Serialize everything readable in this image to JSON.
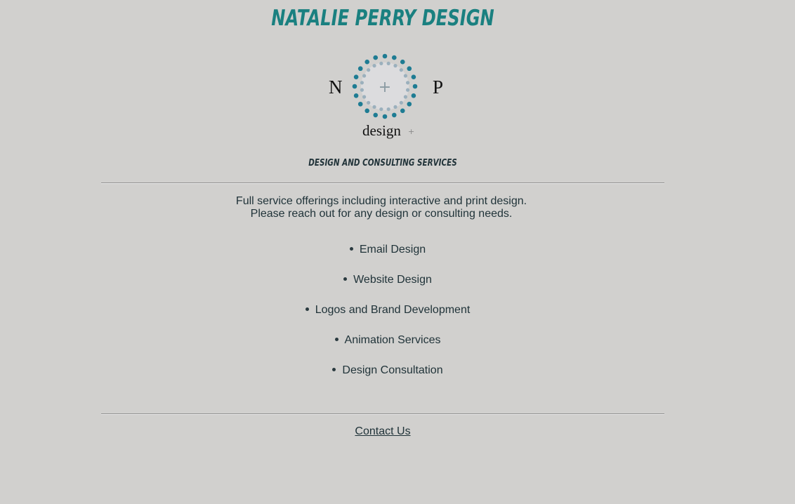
{
  "header": {
    "title": "NATALIE PERRY DESIGN"
  },
  "logo": {
    "left_letter": "N",
    "right_letter": "P",
    "center_symbol": "+",
    "wordmark": "design",
    "wordmark_suffix": "+",
    "ring_colors": [
      "#1e7c93",
      "#9bb0bd"
    ],
    "icon": "dotted-circle-logo"
  },
  "tagline": "DESIGN AND CONSULTING SERVICES",
  "intro": {
    "line1": "Full service offerings including interactive and print design.",
    "line2": "Please reach out for any design or consulting needs."
  },
  "services": [
    {
      "label": "Email Design"
    },
    {
      "label": "Website Design"
    },
    {
      "label": "Logos and Brand Development"
    },
    {
      "label": "Animation Services"
    },
    {
      "label": "Design Consultation"
    }
  ],
  "footer": {
    "contact_label": "Contact Us"
  },
  "colors": {
    "background": "#d1d0ce",
    "title": "#1a8080",
    "text": "#1f3238"
  }
}
